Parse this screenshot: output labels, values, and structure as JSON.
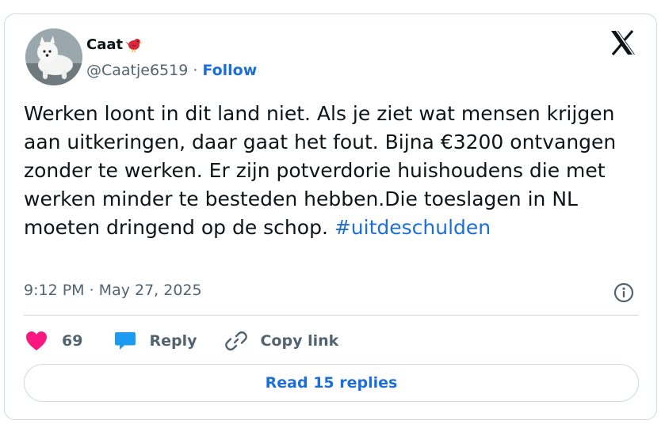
{
  "author": {
    "display_name": "Caat",
    "handle": "@Caatje6519",
    "separator": "·",
    "follow_label": "Follow"
  },
  "tweet": {
    "text": "Werken loont in dit land niet. Als je ziet wat mensen krijgen aan uitkeringen, daar gaat het fout. Bijna €3200 ontvangen zonder te werken. Er zijn potverdorie huishoudens die met werken minder te besteden hebben.Die toeslagen in NL moeten dringend op de schop. ",
    "hashtag": "#uitdeschulden",
    "timestamp": "9:12 PM · May 27, 2025"
  },
  "actions": {
    "like_count": "69",
    "reply_label": "Reply",
    "copy_link_label": "Copy link",
    "read_replies_label": "Read 15 replies"
  },
  "icons": {
    "logo": "x-logo-icon",
    "like": "heart-icon",
    "reply": "speech-bubble-icon",
    "copy": "link-icon",
    "info": "info-icon",
    "badge": "red-bird-icon"
  },
  "colors": {
    "link": "#1d6fd8",
    "like": "#f91880",
    "reply": "#1d9bf0",
    "secondary_text": "#536471",
    "border": "#cfd9de"
  }
}
